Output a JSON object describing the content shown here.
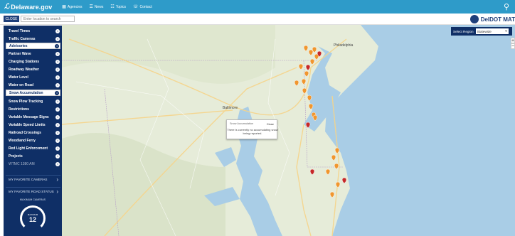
{
  "header": {
    "logo_mark": "ℒ",
    "site_name": "Delaware.gov",
    "nav": [
      {
        "icon": "building-icon",
        "glyph": "▦",
        "label": "Agencies"
      },
      {
        "icon": "news-icon",
        "glyph": "☰",
        "label": "News"
      },
      {
        "icon": "topics-icon",
        "glyph": "☷",
        "label": "Topics"
      },
      {
        "icon": "contact-icon",
        "glyph": "☏",
        "label": "Contact"
      }
    ],
    "search_glyph": "⚲"
  },
  "toolbar": {
    "close_label": "CLOSE",
    "search_placeholder": "Enter location to search",
    "brand": "DelDOT MAT"
  },
  "sidebar": {
    "items": [
      {
        "label": "Travel Times",
        "active": false
      },
      {
        "label": "Traffic Cameras",
        "active": false
      },
      {
        "label": "Advisories",
        "active": true
      },
      {
        "label": "Partner Wave",
        "active": false
      },
      {
        "label": "Charging Stations",
        "active": false
      },
      {
        "label": "Roadway Weather",
        "active": false
      },
      {
        "label": "Water Level",
        "active": false
      },
      {
        "label": "Water on Road",
        "active": false
      },
      {
        "label": "Snow Accumulation",
        "active": true
      },
      {
        "label": "Snow Plow Tracking",
        "active": false
      },
      {
        "label": "Restrictions",
        "active": false
      },
      {
        "label": "Variable Message Signs",
        "active": false
      },
      {
        "label": "Variable Speed Limits",
        "active": false
      },
      {
        "label": "Railroad Crossings",
        "active": false
      },
      {
        "label": "Woodland Ferry",
        "active": false
      },
      {
        "label": "Red Light Enforcement",
        "active": false
      },
      {
        "label": "Projects",
        "active": false
      },
      {
        "label": "WTMC 1380 AM",
        "active": false,
        "muted": true
      }
    ],
    "info_glyph": "i",
    "links": [
      {
        "label": "MY FAVORITE CAMERAS",
        "chevron": "›"
      },
      {
        "label": "MY FAVORITE ROAD STATUS",
        "chevron": "›"
      }
    ],
    "gauge_caption": "MAXIMUM CAMERAS",
    "gauge_label": "MAXIMUM",
    "gauge_value": "12"
  },
  "map": {
    "region_label": "Select Region",
    "region_value": "Statewide",
    "zoom_in": "+",
    "zoom_out": "−",
    "city_labels": {
      "baltimore": "Baltimore",
      "philadelphia": "Philadelphia"
    },
    "popup": {
      "title": "Snow Accumulation",
      "close": "Close",
      "message": "There is currently no accumulating snow being reported."
    },
    "colors": {
      "land": "#e6ecd9",
      "water": "#a9cde6",
      "marker_orange": "#f0962e",
      "marker_red": "#c62828"
    }
  }
}
